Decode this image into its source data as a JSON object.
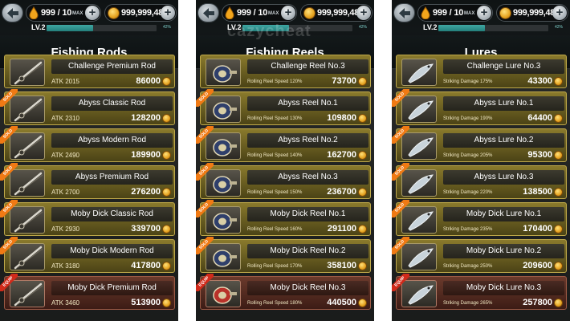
{
  "header": {
    "energy": "999 / 10",
    "energy_max": "MAX",
    "coins": "999,999,489",
    "level": "LV.2",
    "level_percent_text": "42%",
    "level_percent": 42
  },
  "watermark": "cazycheat",
  "panels": [
    {
      "title": "Fishing Rods",
      "items": [
        {
          "name": "Challenge Premium Rod",
          "stat": "ATK 2015",
          "price": "86000",
          "status": "none"
        },
        {
          "name": "Abyss Classic Rod",
          "stat": "ATK 2310",
          "price": "128200",
          "status": "SOLD"
        },
        {
          "name": "Abyss Modern Rod",
          "stat": "ATK 2490",
          "price": "189900",
          "status": "SOLD"
        },
        {
          "name": "Abyss Premium Rod",
          "stat": "ATK 2700",
          "price": "276200",
          "status": "SOLD"
        },
        {
          "name": "Moby Dick Classic Rod",
          "stat": "ATK 2930",
          "price": "339700",
          "status": "SOLD"
        },
        {
          "name": "Moby Dick Modern Rod",
          "stat": "ATK 3180",
          "price": "417800",
          "status": "SOLD"
        },
        {
          "name": "Moby Dick Premium Rod",
          "stat": "ATK 3460",
          "price": "513900",
          "status": "EQUIP"
        }
      ]
    },
    {
      "title": "Fishing Reels",
      "items": [
        {
          "name": "Challenge Reel No.3",
          "stat": "Rolling Reel Speed 120%",
          "price": "73700",
          "status": "none"
        },
        {
          "name": "Abyss Reel No.1",
          "stat": "Rolling Reel Speed 130%",
          "price": "109800",
          "status": "SOLD"
        },
        {
          "name": "Abyss Reel No.2",
          "stat": "Rolling Reel Speed 140%",
          "price": "162700",
          "status": "SOLD"
        },
        {
          "name": "Abyss Reel No.3",
          "stat": "Rolling Reel Speed 150%",
          "price": "236700",
          "status": "SOLD"
        },
        {
          "name": "Moby Dick Reel No.1",
          "stat": "Rolling Reel Speed 160%",
          "price": "291100",
          "status": "SOLD"
        },
        {
          "name": "Moby Dick Reel No.2",
          "stat": "Rolling Reel Speed 170%",
          "price": "358100",
          "status": "SOLD"
        },
        {
          "name": "Moby Dick Reel No.3",
          "stat": "Rolling Reel Speed 180%",
          "price": "440500",
          "status": "EQUIP"
        }
      ]
    },
    {
      "title": "Lures",
      "items": [
        {
          "name": "Challenge Lure No.3",
          "stat": "Striking Damage 175%",
          "price": "43300",
          "status": "none"
        },
        {
          "name": "Abyss Lure No.1",
          "stat": "Striking Damage 190%",
          "price": "64400",
          "status": "SOLD"
        },
        {
          "name": "Abyss Lure No.2",
          "stat": "Striking Damage 205%",
          "price": "95300",
          "status": "SOLD"
        },
        {
          "name": "Abyss Lure No.3",
          "stat": "Striking Damage 220%",
          "price": "138500",
          "status": "SOLD"
        },
        {
          "name": "Moby Dick Lure No.1",
          "stat": "Striking Damage 235%",
          "price": "170400",
          "status": "SOLD"
        },
        {
          "name": "Moby Dick Lure No.2",
          "stat": "Striking Damage 250%",
          "price": "209600",
          "status": "SOLD"
        },
        {
          "name": "Moby Dick Lure No.3",
          "stat": "Striking Damage 265%",
          "price": "257800",
          "status": "EQUIP"
        }
      ]
    }
  ],
  "colors": {
    "sold_tag": "#f07a14",
    "equip_tag": "#d12a1a",
    "level_bar": "#2f9e99",
    "coin": "#e5a320"
  },
  "icons": {
    "back": "back-arrow-icon",
    "energy": "water-drop-icon",
    "coins": "coin-icon",
    "add": "plus-icon"
  }
}
